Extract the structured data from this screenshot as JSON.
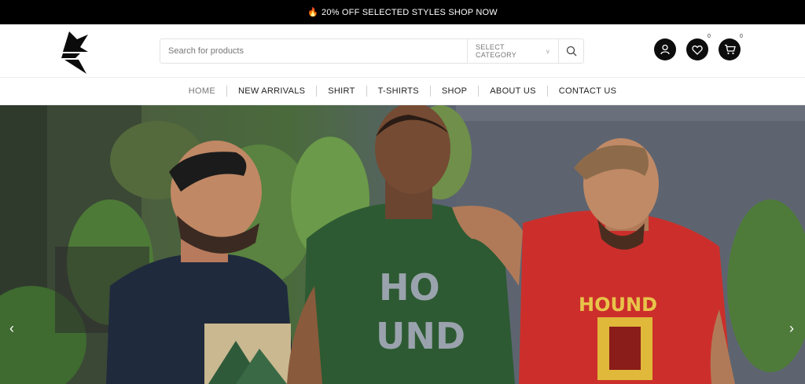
{
  "topbar": {
    "icon": "flame-icon",
    "text": "20% OFF SELECTED STYLES SHOP NOW"
  },
  "search": {
    "placeholder": "Search for products",
    "category_label": "SELECT CATEGORY"
  },
  "header_icons": {
    "wishlist_count": "0",
    "cart_count": "0"
  },
  "nav": {
    "items": [
      "HOME",
      "NEW ARRIVALS",
      "SHIRT",
      "T-SHIRTS",
      "SHOP",
      "ABOUT US",
      "CONTACT US"
    ],
    "active": "HOME"
  },
  "hero": {
    "shirt_prints": {
      "green": [
        "HO",
        "UND"
      ],
      "red": "HOUND"
    },
    "colors": {
      "navy_shirt": "#1f2a3d",
      "green_shirt": "#2d5a32",
      "red_shirt": "#cc2f2b"
    }
  },
  "colors": {
    "topbar_bg": "#000000",
    "accent": "#e8762b",
    "icon_circle": "#0d0d0d"
  }
}
